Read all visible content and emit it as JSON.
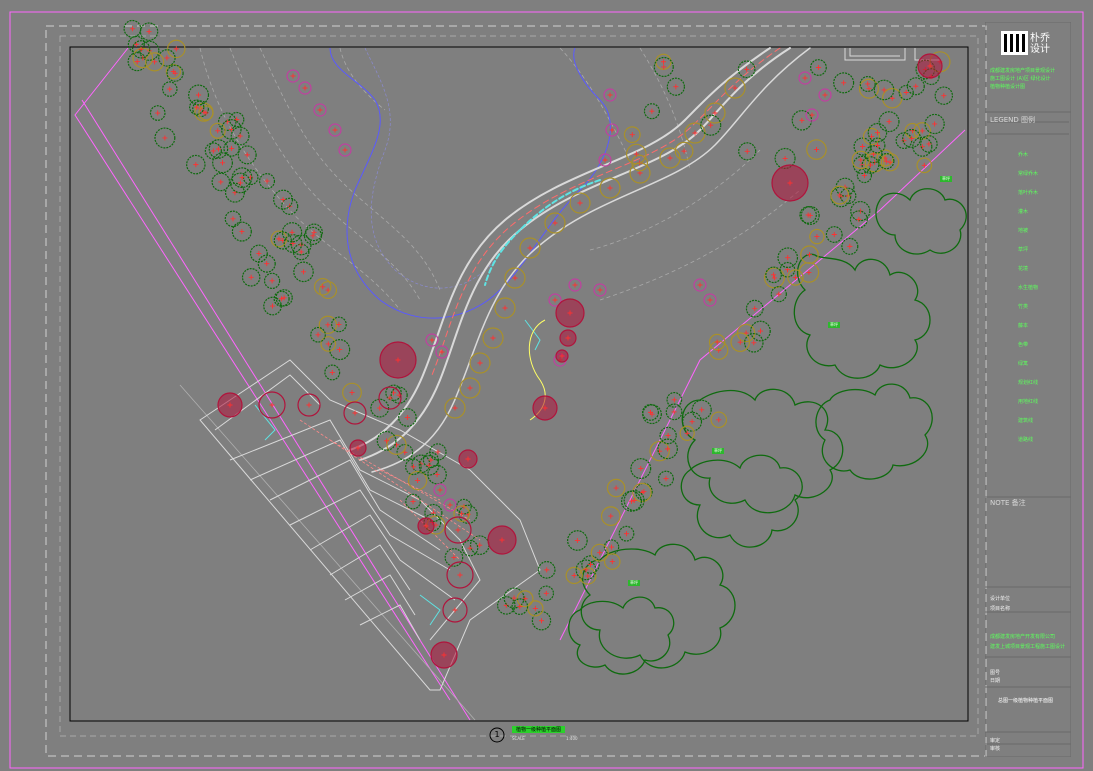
{
  "logo": {
    "text_cn": "朴乔设计",
    "line1": "朴乔",
    "line2": "设计"
  },
  "title_block": {
    "project_lines": [
      "成都建发房地产项目景观设计",
      "施工图设计 (A)区 绿化设计",
      "植物种植设计图"
    ],
    "legend_label": "LEGEND 图例",
    "note_label": "NOTE 备注",
    "legend_items": [
      "乔木",
      "常绿乔木",
      "落叶乔木",
      "灌木",
      "地被",
      "草坪",
      "花境",
      "水生植物",
      "竹类",
      "藤本",
      "色带",
      "绿篱",
      "规划红线",
      "用地红线",
      "建筑线",
      "道路线"
    ],
    "info_lines": [
      "设计单位",
      "项目名称",
      "成都建发房地产开发有限公司",
      "建发上城项目景观工程施工图设计",
      "图号",
      "日期",
      "审定",
      "审核"
    ],
    "drawing_title": "总图一级植物种植平面图"
  },
  "plan": {
    "caption_number": "1",
    "caption_text": "植物一级种植平面图",
    "scale_left": "SCALE",
    "scale_right": "1:400",
    "labels": [
      "草坪",
      "草坪",
      "草坪",
      "草坪",
      "草坪"
    ]
  },
  "colors": {
    "background": "#7f7f7f",
    "frame": "#000000",
    "outer_border": "#ff66ff",
    "tree_green": "#0f6b0f",
    "tree_olive": "#a8902a",
    "tree_red": "#b0143c",
    "tree_magenta": "#c040a0",
    "road": "#d9d9d9",
    "water": "#5a5aff"
  }
}
